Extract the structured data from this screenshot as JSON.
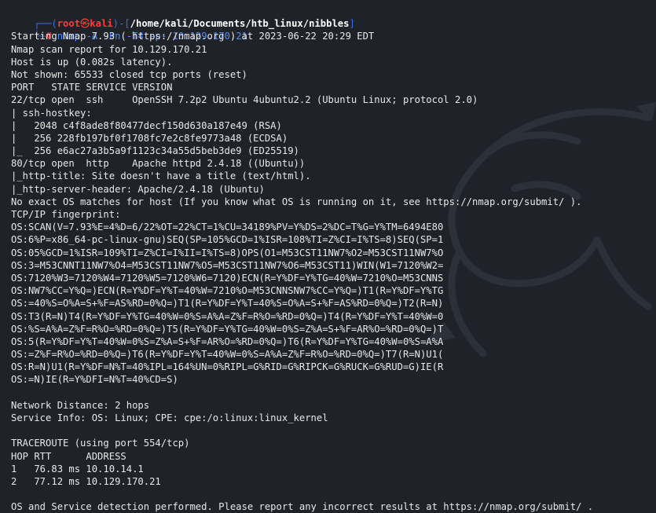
{
  "prompt": {
    "open": "┌──(",
    "user": "root",
    "at": "㉿",
    "host": "kali",
    "mid": ")-[",
    "path": "/home/kali/Documents/htb_linux/nibbles",
    "close": "]",
    "arrow": "└─",
    "hash": "# ",
    "command_parts": [
      "nmap",
      "-A",
      "-Pn",
      "-T4",
      "-p-",
      "10.129.170.21"
    ]
  },
  "output": [
    "Starting Nmap 7.93 ( https://nmap.org ) at 2023-06-22 20:29 EDT",
    "Nmap scan report for 10.129.170.21",
    "Host is up (0.082s latency).",
    "Not shown: 65533 closed tcp ports (reset)",
    "PORT   STATE SERVICE VERSION",
    "22/tcp open  ssh     OpenSSH 7.2p2 Ubuntu 4ubuntu2.2 (Ubuntu Linux; protocol 2.0)",
    "| ssh-hostkey:",
    "|   2048 c4f8ade8f80477decf150d630a187e49 (RSA)",
    "|   256 228fb197bf0f1708fc7e2c8fe9773a48 (ECDSA)",
    "|_  256 e6ac27a3b5a9f1123c34a55d5beb3de9 (ED25519)",
    "80/tcp open  http    Apache httpd 2.4.18 ((Ubuntu))",
    "|_http-title: Site doesn't have a title (text/html).",
    "|_http-server-header: Apache/2.4.18 (Ubuntu)",
    "No exact OS matches for host (If you know what OS is running on it, see https://nmap.org/submit/ ).",
    "TCP/IP fingerprint:",
    "OS:SCAN(V=7.93%E=4%D=6/22%OT=22%CT=1%CU=34189%PV=Y%DS=2%DC=T%G=Y%TM=6494E80",
    "OS:6%P=x86_64-pc-linux-gnu)SEQ(SP=105%GCD=1%ISR=108%TI=Z%CI=I%TS=8)SEQ(SP=1",
    "OS:05%GCD=1%ISR=109%TI=Z%CI=I%II=I%TS=8)OPS(O1=M53CST11NW7%O2=M53CST11NW7%O",
    "OS:3=M53CNNT11NW7%O4=M53CST11NW7%O5=M53CST11NW7%O6=M53CST11)WIN(W1=7120%W2=",
    "OS:7120%W3=7120%W4=7120%W5=7120%W6=7120)ECN(R=Y%DF=Y%TG=40%W=7210%O=M53CNNS",
    "OS:NW7%CC=Y%Q=)ECN(R=Y%DF=Y%T=40%W=7210%O=M53CNNSNW7%CC=Y%Q=)T1(R=Y%DF=Y%TG",
    "OS:=40%S=O%A=S+%F=AS%RD=0%Q=)T1(R=Y%DF=Y%T=40%S=O%A=S+%F=AS%RD=0%Q=)T2(R=N)",
    "OS:T3(R=N)T4(R=Y%DF=Y%TG=40%W=0%S=A%A=Z%F=R%O=%RD=0%Q=)T4(R=Y%DF=Y%T=40%W=0",
    "OS:%S=A%A=Z%F=R%O=%RD=0%Q=)T5(R=Y%DF=Y%TG=40%W=0%S=Z%A=S+%F=AR%O=%RD=0%Q=)T",
    "OS:5(R=Y%DF=Y%T=40%W=0%S=Z%A=S+%F=AR%O=%RD=0%Q=)T6(R=Y%DF=Y%TG=40%W=0%S=A%A",
    "OS:=Z%F=R%O=%RD=0%Q=)T6(R=Y%DF=Y%T=40%W=0%S=A%A=Z%F=R%O=%RD=0%Q=)T7(R=N)U1(",
    "OS:R=N)U1(R=Y%DF=N%T=40%IPL=164%UN=0%RIPL=G%RID=G%RIPCK=G%RUCK=G%RUD=G)IE(R",
    "OS:=N)IE(R=Y%DFI=N%T=40%CD=S)",
    "",
    "Network Distance: 2 hops",
    "Service Info: OS: Linux; CPE: cpe:/o:linux:linux_kernel",
    "",
    "TRACEROUTE (using port 554/tcp)",
    "HOP RTT      ADDRESS",
    "1   76.83 ms 10.10.14.1",
    "2   77.12 ms 10.129.170.21",
    "",
    "OS and Service detection performed. Please report any incorrect results at https://nmap.org/submit/ ."
  ],
  "colors": {
    "background": "#1f2229",
    "prompt_frame": "#3d6fd9",
    "prompt_root": "#ff3b3b",
    "command": "#4d8cff",
    "text": "#e8e8e8"
  },
  "icons": {
    "background_logo": "kali-dragon-icon"
  }
}
